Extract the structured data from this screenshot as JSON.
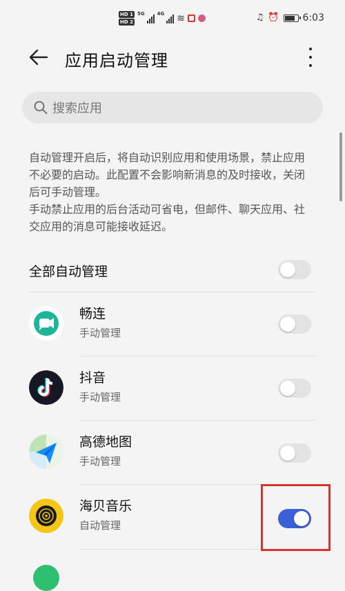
{
  "status_bar": {
    "hd1": "HD 1",
    "hd2": "HD 2",
    "signal1_label": "5G",
    "signal2_label": "4G",
    "time": "6:03",
    "battery_level": 0.85
  },
  "header": {
    "title": "应用启动管理"
  },
  "search": {
    "placeholder": "搜索应用"
  },
  "description": {
    "paragraph1": "自动管理开启后，将自动识别应用和使用场景，禁止应用不必要的启动。此配置不会影响新消息的及时接收，关闭后可手动管理。",
    "paragraph2": "手动禁止应用的后台活动可省电，但邮件、聊天应用、社交应用的消息可能接收延迟。"
  },
  "master": {
    "label": "全部自动管理",
    "enabled": false
  },
  "apps": [
    {
      "name": "畅连",
      "status": "手动管理",
      "enabled": false,
      "icon": "changlian-icon"
    },
    {
      "name": "抖音",
      "status": "手动管理",
      "enabled": false,
      "icon": "douyin-icon"
    },
    {
      "name": "高德地图",
      "status": "手动管理",
      "enabled": false,
      "icon": "amap-icon"
    },
    {
      "name": "海贝音乐",
      "status": "自动管理",
      "enabled": true,
      "icon": "hiby-music-icon"
    }
  ],
  "colors": {
    "toggle_on": "#3a5fd6",
    "toggle_off": "#e3e3e3",
    "highlight": "#d8332b"
  }
}
